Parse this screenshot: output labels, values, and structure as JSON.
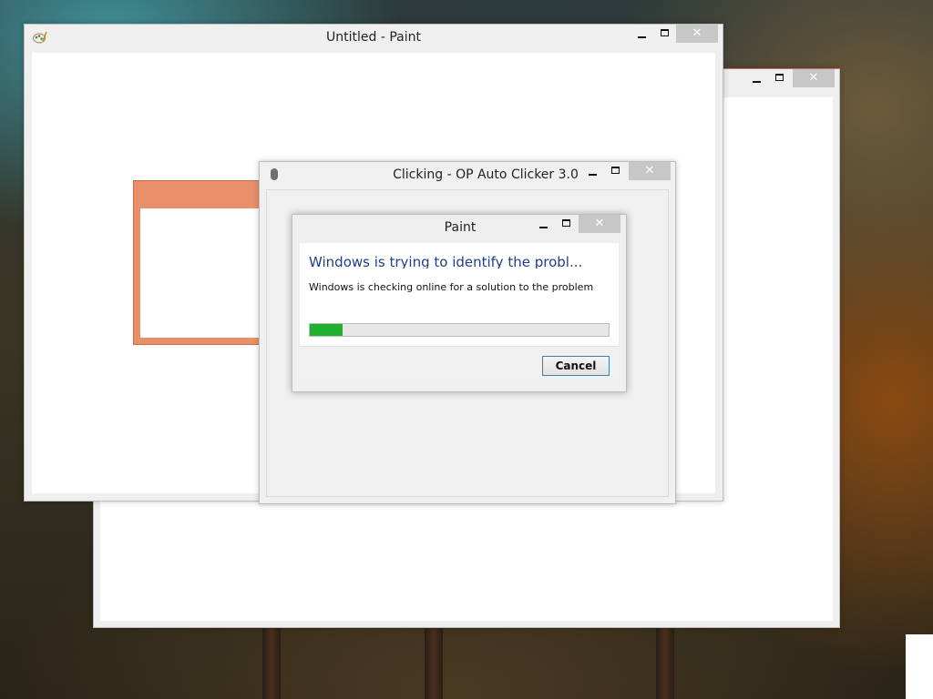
{
  "paint_window": {
    "title": "Untitled - Paint",
    "close_glyph": "✕",
    "icon": "paint-app-icon",
    "canvas_shape_color": "#e9906a"
  },
  "background_window": {
    "close_glyph": "✕",
    "accent_color": "#d56a6a"
  },
  "clicker_window": {
    "title": "Clicking - OP Auto Clicker 3.0",
    "close_glyph": "✕",
    "icon": "mouse-icon"
  },
  "error_dialog": {
    "title": "Paint",
    "close_glyph": "✕",
    "heading": "Windows is trying to identify the probl...",
    "message": "Windows is checking online for a solution to the problem",
    "progress": 0.11,
    "progress_color": "#1eb02e",
    "cancel_label": "Cancel"
  }
}
